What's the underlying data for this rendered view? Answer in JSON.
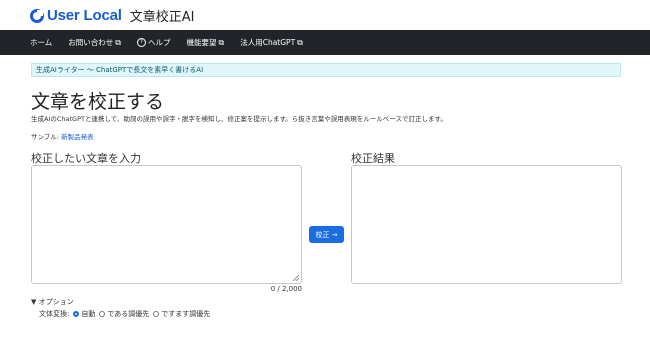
{
  "header": {
    "logo_text": "User Local",
    "app_title": "文章校正AI"
  },
  "nav": {
    "home": "ホーム",
    "contact": "お問い合わせ",
    "help": "ヘルプ",
    "feature_request": "機能要望",
    "corporate": "法人用ChatGPT"
  },
  "banner": {
    "text": "生成AIライター 〜 ChatGPTで長文を素早く書けるAI"
  },
  "main": {
    "title": "文章を校正する",
    "description": "生成AIのChatGPTと連携して、助詞の誤用や誤字・脱字を検知し、修正案を提示します。ら抜き言葉や誤用表現をルールベースで訂正します。",
    "sample_label": "サンプル:",
    "sample_link": "新製品発表",
    "input_label": "校正したい文章を入力",
    "result_label": "校正結果",
    "submit_label": "校正 →",
    "counter": "0 / 2,000"
  },
  "options": {
    "toggle": "▼ オプション",
    "style_label": "文体変換:",
    "choices": [
      "自動",
      "である調優先",
      "ですます調優先"
    ],
    "selected": "自動"
  },
  "colors": {
    "brand": "#1a5bd6",
    "nav_bg": "#212529",
    "button": "#1a6de0",
    "banner_bg": "#dff6fb"
  }
}
